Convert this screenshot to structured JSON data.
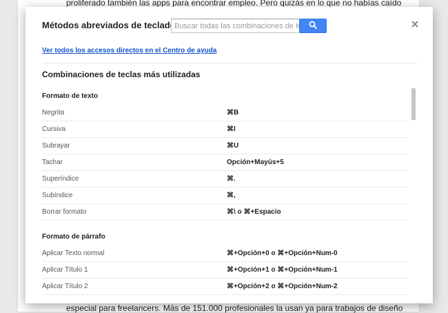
{
  "background_doc": {
    "top_text": "proliferado también las apps para encontrar empleo. Pero quizás en lo que no habías caído",
    "bottom_text": "especial para freelancers. Más de 151.000 profesionales la usan ya para trabajos de diseño"
  },
  "dialog": {
    "title": "Métodos abreviados de teclado",
    "search_placeholder": "Buscar todas las combinaciones de teclas",
    "search_value": "",
    "search_icon": "search-icon",
    "close_icon": "close-icon",
    "help_link": "Ver todos los accesos directos en el Centro de ayuda",
    "section_heading": "Combinaciones de teclas más utilizadas"
  },
  "groups": [
    {
      "title": "Formato de texto",
      "rows": [
        {
          "action": "Negrita",
          "keys": "⌘B"
        },
        {
          "action": "Cursiva",
          "keys": "⌘I"
        },
        {
          "action": "Subrayar",
          "keys": "⌘U"
        },
        {
          "action": "Tachar",
          "keys": "Opción+Mayús+5"
        },
        {
          "action": "Superíndice",
          "keys": "⌘."
        },
        {
          "action": "Subíndice",
          "keys": "⌘,"
        },
        {
          "action": "Borrar formato",
          "keys": "⌘\\ o ⌘+Espacio"
        }
      ]
    },
    {
      "title": "Formato de párrafo",
      "rows": [
        {
          "action": "Aplicar Texto normal",
          "keys": "⌘+Opción+0 o ⌘+Opción+Num-0"
        },
        {
          "action": "Aplicar Título 1",
          "keys": "⌘+Opción+1 o ⌘+Opción+Num-1"
        },
        {
          "action": "Aplicar Título 2",
          "keys": "⌘+Opción+2 o ⌘+Opción+Num-2"
        }
      ]
    }
  ],
  "colors": {
    "accent": "#4285f4",
    "link": "#1155cc"
  }
}
